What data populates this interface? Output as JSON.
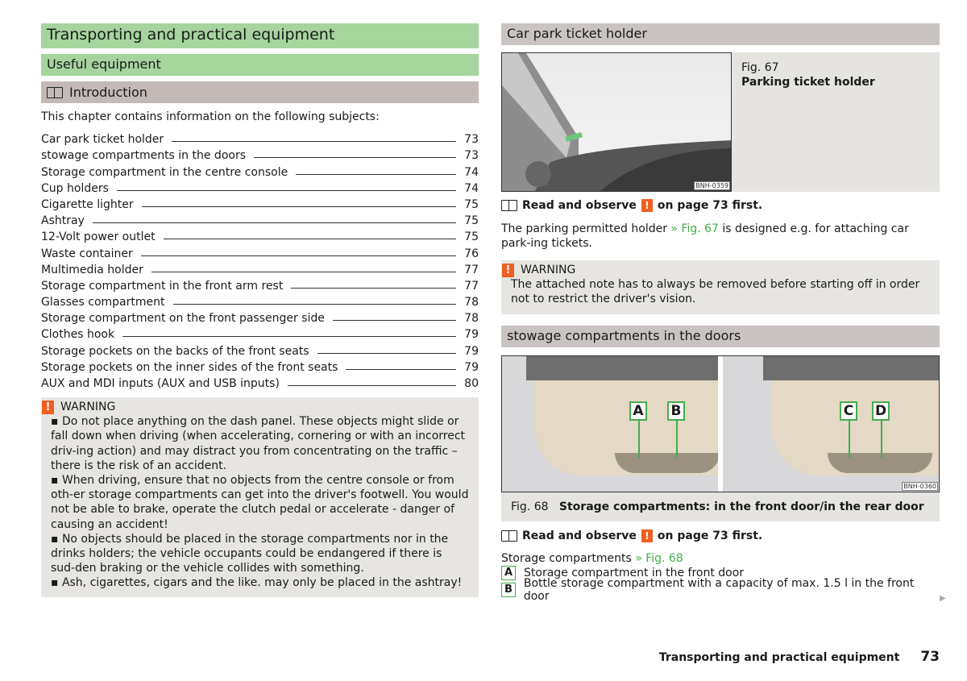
{
  "left": {
    "chapter_title": "Transporting and practical equipment",
    "section_title": "Useful equipment",
    "subsection_title": "Introduction",
    "intro_text": "This chapter contains information on the following subjects:",
    "toc": [
      {
        "label": "Car park ticket holder",
        "page": "73"
      },
      {
        "label": "stowage compartments in the doors",
        "page": "73"
      },
      {
        "label": "Storage compartment in the centre console",
        "page": "74"
      },
      {
        "label": "Cup holders",
        "page": "74"
      },
      {
        "label": "Cigarette lighter",
        "page": "75"
      },
      {
        "label": "Ashtray",
        "page": "75"
      },
      {
        "label": "12-Volt power outlet",
        "page": "75"
      },
      {
        "label": "Waste container",
        "page": "76"
      },
      {
        "label": "Multimedia holder",
        "page": "77"
      },
      {
        "label": "Storage compartment in the front arm rest",
        "page": "77"
      },
      {
        "label": "Glasses compartment",
        "page": "78"
      },
      {
        "label": "Storage compartment on the front passenger side",
        "page": "78"
      },
      {
        "label": "Clothes hook",
        "page": "79"
      },
      {
        "label": "Storage pockets on the backs of the front seats",
        "page": "79"
      },
      {
        "label": "Storage pockets on the inner sides of the front seats",
        "page": "79"
      },
      {
        "label": "AUX and MDI inputs (AUX and USB inputs)",
        "page": "80"
      }
    ],
    "warning": {
      "title": "WARNING",
      "items": [
        "▪ Do not place anything on the dash panel. These objects might slide or fall down when driving (when accelerating, cornering or with an incorrect driv-ing action) and may distract you from concentrating on the traffic – there is the risk of an accident.",
        "▪ When driving, ensure that no objects from the centre console or from oth-er storage compartments can get into the driver's footwell. You would not be able to brake, operate the clutch pedal or accelerate - danger of causing an accident!",
        "▪ No objects should be placed in the storage compartments nor in the drinks holders; the vehicle occupants could be endangered if there is sud-den braking or the vehicle collides with something.",
        "▪ Ash, cigarettes, cigars and the like. may only be placed in the ashtray!"
      ]
    }
  },
  "right": {
    "s1": {
      "title": "Car park ticket holder",
      "fig_num": "Fig. 67",
      "fig_caption": "Parking ticket holder",
      "fig_code": "BNH-0359",
      "read_pre": "Read and observe",
      "read_post": "on page 73 first.",
      "body_pre": "The parking permitted holder",
      "body_link": "» Fig. 67",
      "body_post": "is designed e.g. for attaching car park-ing tickets.",
      "warning_title": "WARNING",
      "warning_text": "The attached note has to always be removed before starting off in order not to restrict the driver's vision."
    },
    "s2": {
      "title": "stowage compartments in the doors",
      "fig_num": "Fig. 68",
      "fig_caption": "Storage compartments: in the front door/in the rear door",
      "fig_code": "BNH-0360",
      "labels": [
        "A",
        "B",
        "C",
        "D"
      ],
      "read_pre": "Read and observe",
      "read_post": "on page 73 first.",
      "list_title": "Storage compartments",
      "list_link": "» Fig. 68",
      "items": [
        {
          "key": "A",
          "text": "Storage compartment in the front door"
        },
        {
          "key": "B",
          "text": "Bottle storage compartment with a capacity of max. 1.5 l in the front door"
        }
      ]
    }
  },
  "footer": {
    "title": "Transporting and practical equipment",
    "page": "73"
  },
  "colors": {
    "heading_green": "#a6d49d",
    "heading_gray": "#c3bab8",
    "warning_orange": "#ef5f22",
    "link_green": "#45ad4a"
  }
}
